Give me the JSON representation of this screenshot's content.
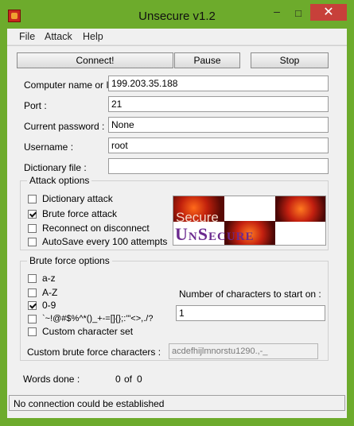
{
  "window": {
    "title": "Unsecure v1.2",
    "minimize_glyph": "–",
    "maximize_glyph": "□",
    "close_glyph": "✕"
  },
  "menu": {
    "file": "File",
    "attack": "Attack",
    "help": "Help"
  },
  "toolbar": {
    "connect_label": "Connect!",
    "pause_label": "Pause",
    "stop_label": "Stop"
  },
  "fields": {
    "computer_label": "Computer name or IP :",
    "computer_value": "199.203.35.188",
    "port_label": "Port :",
    "port_value": "21",
    "password_label": "Current password :",
    "password_value": "None",
    "username_label": "Username :",
    "username_value": "root",
    "dictionary_label": "Dictionary file :",
    "dictionary_value": ""
  },
  "attack_options": {
    "title": "Attack options",
    "items": [
      {
        "label": "Dictionary attack",
        "checked": false
      },
      {
        "label": "Brute force attack",
        "checked": true
      },
      {
        "label": "Reconnect on disconnect",
        "checked": false
      },
      {
        "label": "AutoSave every 100 attempts",
        "checked": false
      }
    ]
  },
  "logo": {
    "top_text": "Secure",
    "bottom_text": "UnSecure",
    "bottom_parts": [
      "U",
      "N",
      "S",
      "ECURE"
    ]
  },
  "brute_force": {
    "title": "Brute force options",
    "items": [
      {
        "label": "a-z",
        "checked": false
      },
      {
        "label": "A-Z",
        "checked": false
      },
      {
        "label": "0-9",
        "checked": true
      },
      {
        "label": "`~!@#$%^*()_+-=[]{};:'\"<>,./?",
        "checked": false
      },
      {
        "label": "Custom character set",
        "checked": false
      }
    ],
    "start_label": "Number of characters to start on :",
    "start_value": "1",
    "custom_label": "Custom brute force characters :",
    "custom_value": "acdefhijlmnorstu1290.,-_"
  },
  "words_done": {
    "label": "Words done :",
    "done": "0",
    "of": "of",
    "total": "0"
  },
  "status_text": "No connection could be established",
  "colors": {
    "frame": "#6dab2c",
    "close": "#c7403a",
    "logo_purple": "#6b2a8f"
  }
}
